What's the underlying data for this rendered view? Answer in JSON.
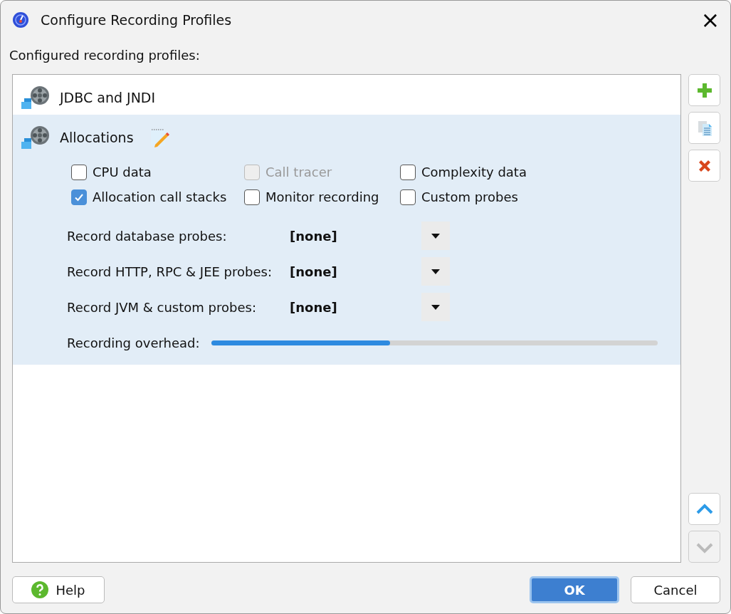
{
  "window": {
    "title": "Configure Recording Profiles",
    "close": "×"
  },
  "list_label": "Configured recording profiles:",
  "profiles": [
    {
      "name": "JDBC and JNDI",
      "selected": false
    },
    {
      "name": "Allocations",
      "selected": true,
      "editable": true,
      "options": [
        {
          "label": "CPU data",
          "checked": false,
          "disabled": false
        },
        {
          "label": "Call tracer",
          "checked": false,
          "disabled": true
        },
        {
          "label": "Complexity data",
          "checked": false,
          "disabled": false
        },
        {
          "label": "Allocation call stacks",
          "checked": true,
          "disabled": false
        },
        {
          "label": "Monitor recording",
          "checked": false,
          "disabled": false
        },
        {
          "label": "Custom probes",
          "checked": false,
          "disabled": false
        }
      ],
      "probes": [
        {
          "label": "Record database probes:",
          "value": "[none]"
        },
        {
          "label": "Record HTTP, RPC & JEE probes:",
          "value": "[none]"
        },
        {
          "label": "Record JVM & custom probes:",
          "value": "[none]"
        }
      ],
      "overhead": {
        "label": "Recording overhead:",
        "level": 0.4
      }
    }
  ],
  "side_buttons": [
    {
      "kind": "add",
      "disabled": false
    },
    {
      "kind": "copy",
      "disabled": false
    },
    {
      "kind": "delete",
      "disabled": false
    },
    {
      "kind": "up",
      "disabled": false
    },
    {
      "kind": "down",
      "disabled": true
    }
  ],
  "buttons": [
    {
      "kind": "help",
      "label": "Help",
      "default": false
    },
    {
      "kind": "ok",
      "label": "OK",
      "default": true
    },
    {
      "kind": "cancel",
      "label": "Cancel",
      "default": false
    }
  ]
}
